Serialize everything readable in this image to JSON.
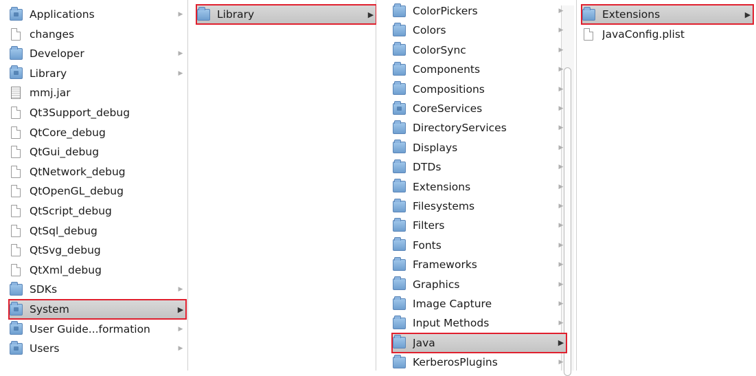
{
  "columns": [
    {
      "items": [
        {
          "label": "Applications",
          "icon": "folder-special-icon",
          "arrow": true
        },
        {
          "label": "changes",
          "icon": "document-icon",
          "arrow": false
        },
        {
          "label": "Developer",
          "icon": "folder-icon",
          "arrow": true
        },
        {
          "label": "Library",
          "icon": "folder-special-icon",
          "arrow": true
        },
        {
          "label": "mmj.jar",
          "icon": "jar-icon",
          "arrow": false
        },
        {
          "label": "Qt3Support_debug",
          "icon": "document-icon",
          "arrow": false
        },
        {
          "label": "QtCore_debug",
          "icon": "document-icon",
          "arrow": false
        },
        {
          "label": "QtGui_debug",
          "icon": "document-icon",
          "arrow": false
        },
        {
          "label": "QtNetwork_debug",
          "icon": "document-icon",
          "arrow": false
        },
        {
          "label": "QtOpenGL_debug",
          "icon": "document-icon",
          "arrow": false
        },
        {
          "label": "QtScript_debug",
          "icon": "document-icon",
          "arrow": false
        },
        {
          "label": "QtSql_debug",
          "icon": "document-icon",
          "arrow": false
        },
        {
          "label": "QtSvg_debug",
          "icon": "document-icon",
          "arrow": false
        },
        {
          "label": "QtXml_debug",
          "icon": "document-icon",
          "arrow": false
        },
        {
          "label": "SDKs",
          "icon": "folder-icon",
          "arrow": true
        },
        {
          "label": "System",
          "icon": "folder-special-icon",
          "arrow": true,
          "selected": true
        },
        {
          "label": "User Guide...formation",
          "icon": "folder-special-icon",
          "arrow": true
        },
        {
          "label": "Users",
          "icon": "folder-special-icon",
          "arrow": true
        }
      ]
    },
    {
      "items": [
        {
          "label": "Library",
          "icon": "folder-icon",
          "arrow": true,
          "selected": true
        }
      ]
    },
    {
      "items": [
        {
          "label": "ColorPickers",
          "icon": "folder-icon",
          "arrow": true
        },
        {
          "label": "Colors",
          "icon": "folder-icon",
          "arrow": true
        },
        {
          "label": "ColorSync",
          "icon": "folder-icon",
          "arrow": true
        },
        {
          "label": "Components",
          "icon": "folder-icon",
          "arrow": true
        },
        {
          "label": "Compositions",
          "icon": "folder-icon",
          "arrow": true
        },
        {
          "label": "CoreServices",
          "icon": "folder-special-icon",
          "arrow": true
        },
        {
          "label": "DirectoryServices",
          "icon": "folder-icon",
          "arrow": true
        },
        {
          "label": "Displays",
          "icon": "folder-icon",
          "arrow": true
        },
        {
          "label": "DTDs",
          "icon": "folder-icon",
          "arrow": true
        },
        {
          "label": "Extensions",
          "icon": "folder-icon",
          "arrow": true
        },
        {
          "label": "Filesystems",
          "icon": "folder-icon",
          "arrow": true
        },
        {
          "label": "Filters",
          "icon": "folder-icon",
          "arrow": true
        },
        {
          "label": "Fonts",
          "icon": "folder-icon",
          "arrow": true
        },
        {
          "label": "Frameworks",
          "icon": "folder-icon",
          "arrow": true
        },
        {
          "label": "Graphics",
          "icon": "folder-icon",
          "arrow": true
        },
        {
          "label": "Image Capture",
          "icon": "folder-icon",
          "arrow": true
        },
        {
          "label": "Input Methods",
          "icon": "folder-icon",
          "arrow": true
        },
        {
          "label": "Java",
          "icon": "folder-icon",
          "arrow": true,
          "selected": true
        },
        {
          "label": "KerberosPlugins",
          "icon": "folder-icon",
          "arrow": true
        }
      ]
    },
    {
      "items": [
        {
          "label": "Extensions",
          "icon": "folder-icon",
          "arrow": true,
          "selected": true
        },
        {
          "label": "JavaConfig.plist",
          "icon": "document-icon",
          "arrow": false
        }
      ]
    }
  ],
  "arrow_glyph": "▶",
  "colors": {
    "selection_outline": "#e0202e",
    "folder": "#7fb0e0"
  }
}
